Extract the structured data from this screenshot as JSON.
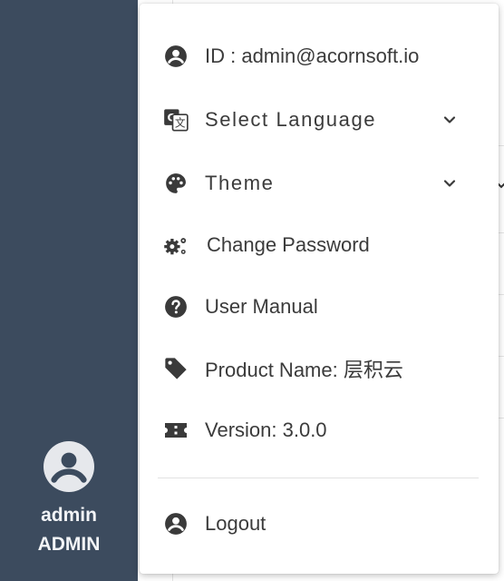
{
  "sidebar": {
    "user_name": "admin",
    "user_role": "ADMIN"
  },
  "menu": {
    "items": [
      {
        "label": "ID : admin@acornsoft.io",
        "icon": "account-circle-icon"
      },
      {
        "label": "Select Language",
        "icon": "translate-icon",
        "expandable": true
      },
      {
        "label": "Theme",
        "icon": "palette-icon",
        "expandable": true
      },
      {
        "label": "Change Password",
        "icon": "gears-icon"
      },
      {
        "label": "User Manual",
        "icon": "help-circle-icon"
      },
      {
        "label": "Product Name: 层积云",
        "icon": "tag-icon"
      },
      {
        "label": "Version: 3.0.0",
        "icon": "ticket-icon"
      }
    ],
    "logout_label": "Logout"
  },
  "colors": {
    "sidebar_bg": "#3c4b5e",
    "icon": "#3a3a3a",
    "text": "#3b3b3b"
  }
}
